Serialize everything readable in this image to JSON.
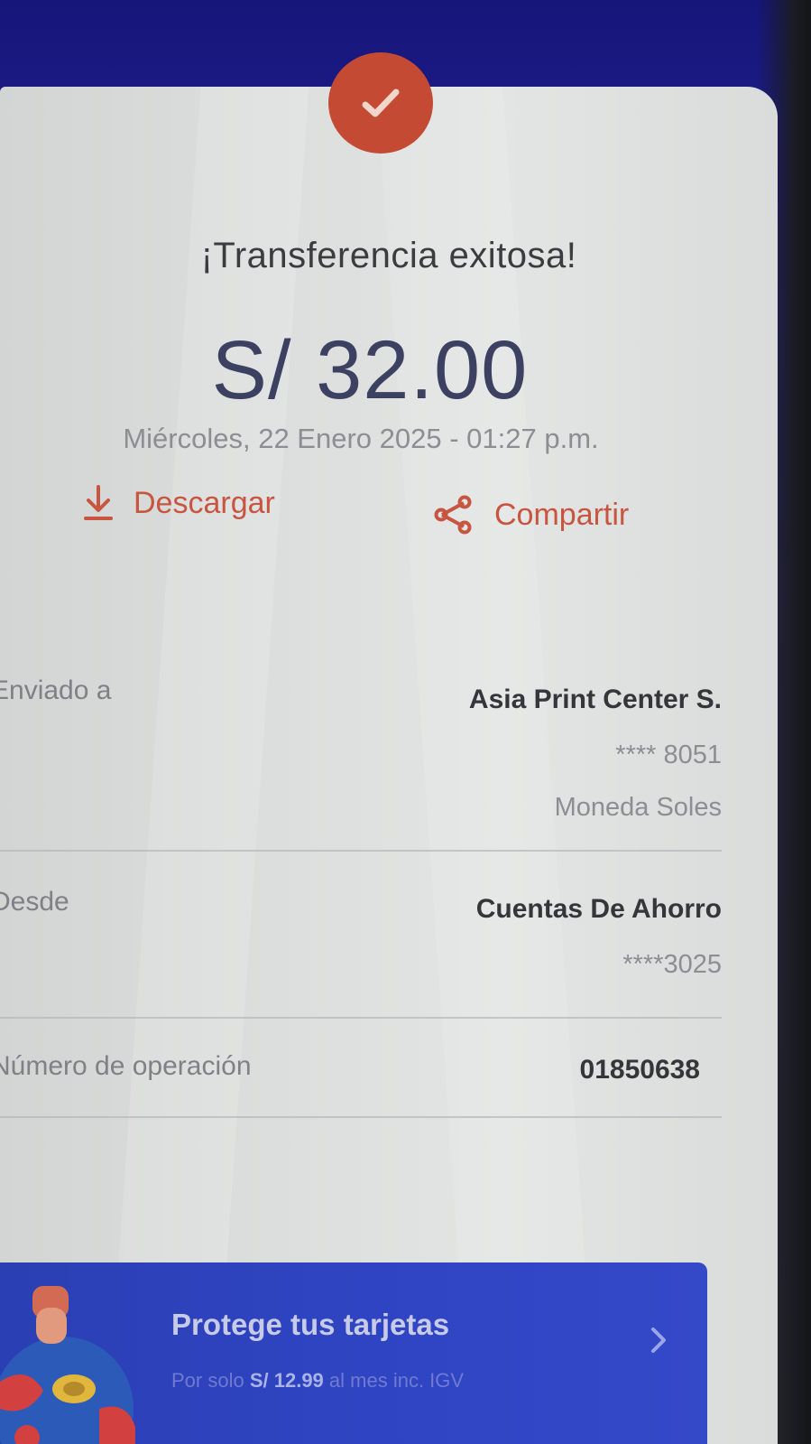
{
  "receipt": {
    "title": "¡Transferencia exitosa!",
    "amount": "S/ 32.00",
    "datetime": "Miércoles, 22 Enero 2025 - 01:27 p.m.",
    "download_label": "Descargar",
    "share_label": "Compartir"
  },
  "details": {
    "sent_to": {
      "label": "Enviado a",
      "name": "Asia Print Center S.",
      "account": "**** 8051",
      "currency": "Moneda Soles"
    },
    "from": {
      "label": "Desde",
      "account_type": "Cuentas De Ahorro",
      "account": "****3025"
    },
    "operation": {
      "label": "Número de operación",
      "number": "01850638"
    }
  },
  "promo": {
    "title": "Protege tus tarjetas",
    "subtitle_prefix": "Por solo",
    "price": "S/ 12.99",
    "subtitle_suffix": "al mes inc. IGV"
  },
  "colors": {
    "accent": "#c7553f",
    "amount": "#3c4162",
    "promo_bg": "#2f45c4",
    "header_bg": "#1c1c86"
  },
  "icons": {
    "badge": "check-icon",
    "download": "download-icon",
    "share": "share-icon",
    "promo": "chevron-right-icon"
  }
}
